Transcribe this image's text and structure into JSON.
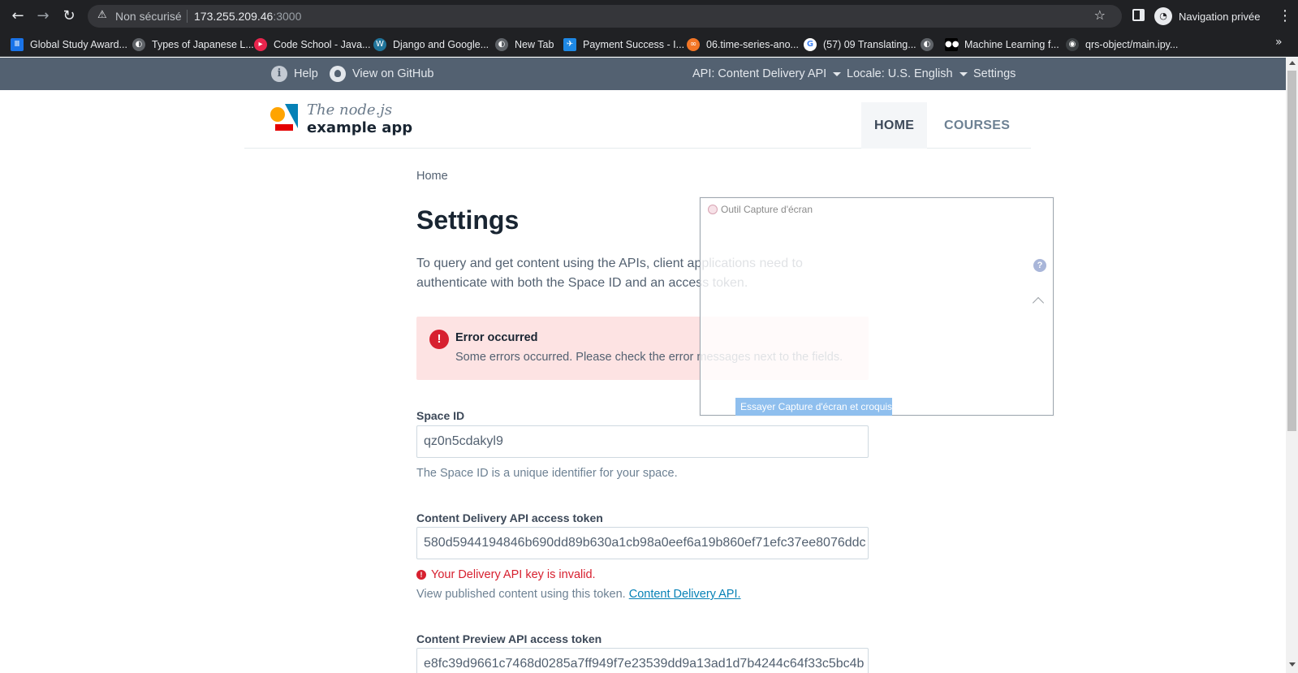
{
  "browser": {
    "security_label": "Non sécurisé",
    "url_host": "173.255.209.46",
    "url_port": ":3000",
    "profile_label": "Navigation privée"
  },
  "bookmarks": [
    {
      "label": "Global Study Award...",
      "icon": "library-icon",
      "color": "#1a73e8"
    },
    {
      "label": "Types of Japanese L...",
      "icon": "globe-icon",
      "color": "#5f6368"
    },
    {
      "label": "Code School - Java...",
      "icon": "codeschool-icon",
      "color": "#e8254d"
    },
    {
      "label": "Django and Google...",
      "icon": "wordpress-icon",
      "color": "#21759b"
    },
    {
      "label": "New Tab",
      "icon": "globe-icon",
      "color": "#5f6368"
    },
    {
      "label": "Payment Success - I...",
      "icon": "payment-icon",
      "color": "#1e88e5"
    },
    {
      "label": "06.time-series-ano...",
      "icon": "jupyter-icon",
      "color": "#f37626"
    },
    {
      "label": "(57) 09 Translating...",
      "icon": "google-icon",
      "color": "#ffffff"
    },
    {
      "label": "Machine Learning f...",
      "icon": "medium-icon",
      "color": "#000000"
    },
    {
      "label": "qrs-object/main.ipy...",
      "icon": "github-icon",
      "color": "#5f6368"
    }
  ],
  "topbar": {
    "help": "Help",
    "github": "View on GitHub",
    "api": "API: Content Delivery API",
    "locale": "Locale: U.S. English",
    "settings": "Settings"
  },
  "header": {
    "logo_line1": "The node.js",
    "logo_line2": "example app",
    "nav_home": "HOME",
    "nav_courses": "COURSES"
  },
  "main": {
    "breadcrumb": "Home",
    "title": "Settings",
    "intro": "To query and get content using the APIs, client applications need to authenticate with both the Space ID and an access token.",
    "alert_title": "Error occurred",
    "alert_message": "Some errors occurred. Please check the error messages next to the fields.",
    "space_label": "Space ID",
    "space_value": "qz0n5cdakyl9",
    "space_help": "The Space ID is a unique identifier for your space.",
    "delivery_label": "Content Delivery API access token",
    "delivery_value": "580d5944194846b690dd89b630a1cb98a0eef6a19b860ef71efc37ee8076ddc",
    "delivery_error": "Your Delivery API key is invalid.",
    "delivery_help": "View published content using this token.",
    "delivery_link": "Content Delivery API.",
    "preview_label": "Content Preview API access token",
    "preview_value": "e8fc39d9661c7468d0285a7ff949f7e23539dd9a13ad1d7b4244c64f33c5bc4b"
  },
  "snip": {
    "title": "Outil Capture d'écran",
    "button": "Essayer Capture d'écran et croquis"
  },
  "colors": {
    "topbar_bg": "#536171",
    "error": "#d7202f",
    "link": "#0681b6",
    "alert_bg": "#fde3e3"
  }
}
